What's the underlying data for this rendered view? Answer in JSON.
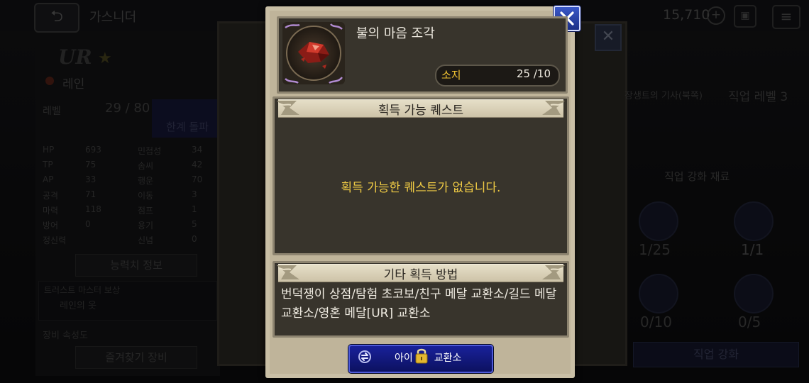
{
  "background": {
    "top_title": "가스니더",
    "currency": "15,710",
    "character": {
      "rank": "UR",
      "name": "레인",
      "level_label": "레벨",
      "level": "29 / 80",
      "limit_break": "한계 돌파",
      "stats": [
        {
          "k1": "HP",
          "v1": "693",
          "k2": "민첩성",
          "v2": "34"
        },
        {
          "k1": "TP",
          "v1": "75",
          "k2": "솜씨",
          "v2": "42"
        },
        {
          "k1": "AP",
          "v1": "33",
          "k2": "행운",
          "v2": "70"
        },
        {
          "k1": "공격",
          "v1": "71",
          "k2": "이동",
          "v2": "3"
        },
        {
          "k1": "마력",
          "v1": "118",
          "k2": "점프",
          "v2": "1"
        },
        {
          "k1": "방어",
          "v1": "0",
          "k2": "용기",
          "v2": "5"
        },
        {
          "k1": "정신력",
          "v1": "",
          "k2": "신념",
          "v2": "0"
        }
      ],
      "ability_info": "능력치 정보",
      "trust_master": "트러스트 마스터 보상",
      "trust_sub": "레인의 옷",
      "equip_set": "장비 속성도",
      "fav_equip": "즐겨찾기 장비"
    },
    "job": {
      "small_text": "장생트의 기사(북쪽)",
      "job_level": "직업 레벨 3",
      "materials_title": "직업 강화 재료",
      "counts": [
        "1/25",
        "1/1",
        "0/10",
        "0/5"
      ],
      "enhance": "직업 강화"
    }
  },
  "popup": {
    "item_name": "불의 마음 조각",
    "owned_label": "소지",
    "owned_value": "25 /10",
    "quest_section_title": "획득 가능 퀘스트",
    "quest_empty_message": "획득 가능한 퀘스트가 없습니다.",
    "other_section_title": "기타 획득 방법",
    "other_methods": "번덕쟁이 상점/탐험 초코보/친구 메달 교환소/길드 메달 교환소/영혼 메달[UR] 교환소",
    "exchange_button_left": "아이",
    "exchange_button_right": "교환소",
    "colors": {
      "highlight_yellow": "#f1cc45",
      "button_blue": "#19219a",
      "panel_brown": "#38342c",
      "frame_tan": "#c9bfa6"
    }
  },
  "icons": [
    "back-icon",
    "star-icon",
    "close-icon",
    "fire-crystal-icon",
    "exchange-icon",
    "lock-icon",
    "plus-icon",
    "gift-icon",
    "menu-icon"
  ]
}
